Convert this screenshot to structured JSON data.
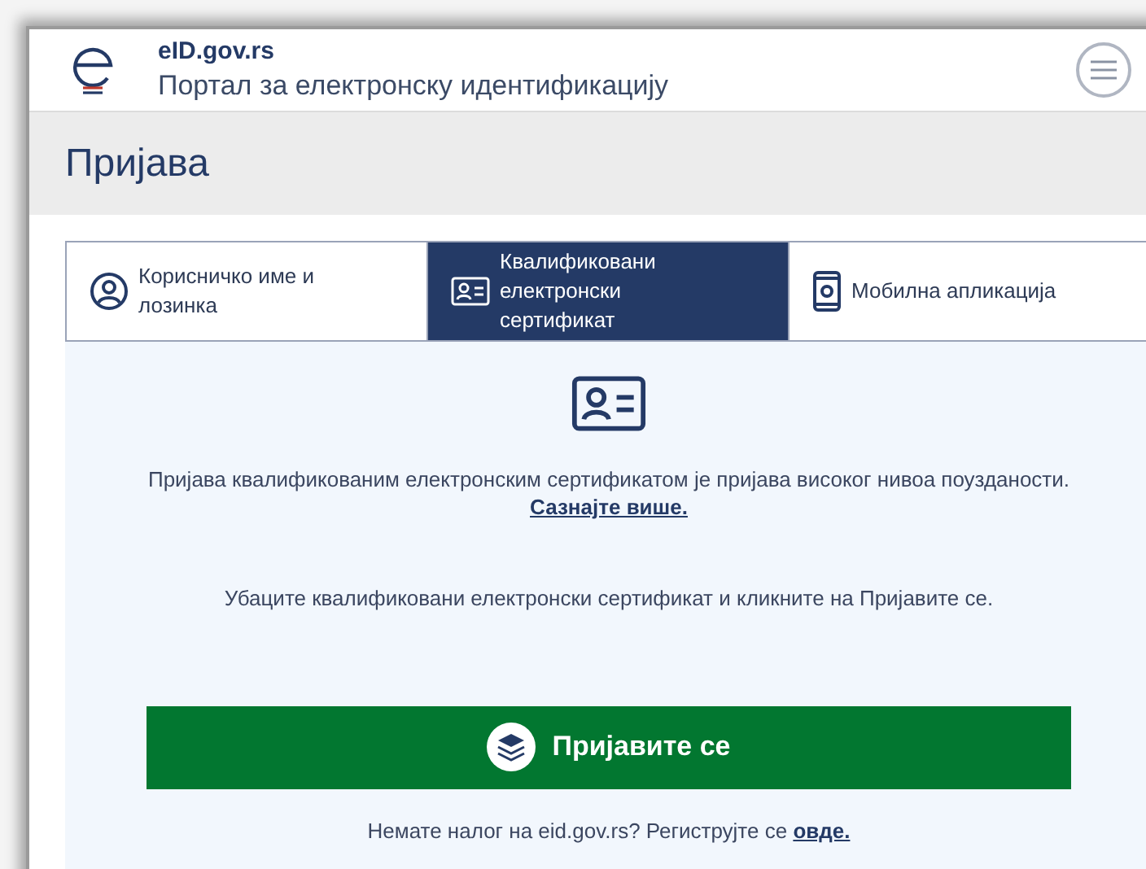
{
  "header": {
    "site": "eID.gov.rs",
    "subtitle": "Портал за електронску идентификацију"
  },
  "page_title": "Пријава",
  "tabs": [
    {
      "kind": "user",
      "label": "Корисничко име и лозинка",
      "selected": false
    },
    {
      "kind": "certificate",
      "label": "Квалификовани електронски сертификат",
      "selected": true
    },
    {
      "kind": "mobile",
      "label": "Мобилна апликација",
      "selected": false
    }
  ],
  "info": {
    "text": "Пријава квалификованим електронским сертификатом је пријава високог нивоа поузданости.",
    "link": "Сазнајте више."
  },
  "instruction": "Убаците квалификовани електронски сертификат и кликните на Пријавите се.",
  "login_button": "Пријавите се",
  "register": {
    "text": "Немате налог на eid.gov.rs? Региструјте се",
    "link": "овде."
  }
}
